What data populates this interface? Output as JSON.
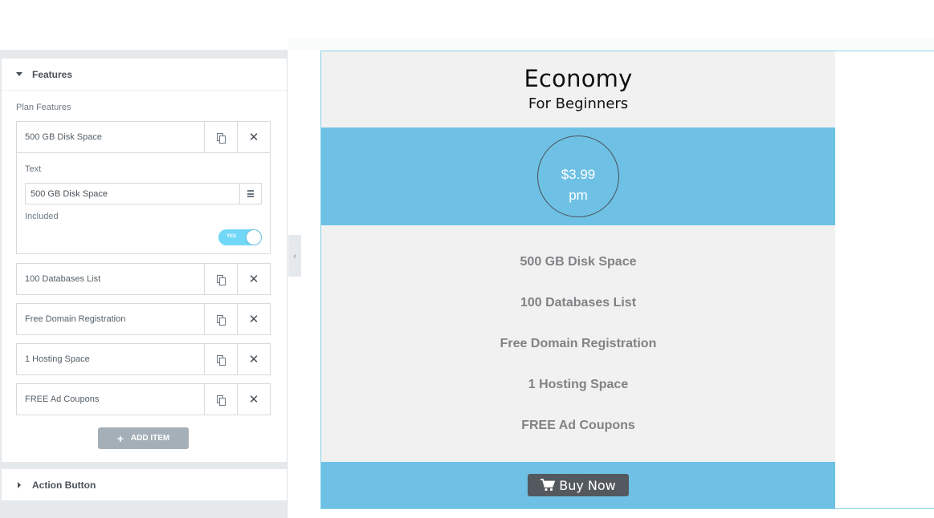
{
  "sidebar": {
    "features_section": {
      "title": "Features"
    },
    "plan_features_label": "Plan Features",
    "items": [
      {
        "title": "500 GB Disk Space",
        "expanded": true
      },
      {
        "title": "100 Databases List"
      },
      {
        "title": "Free Domain Registration"
      },
      {
        "title": "1 Hosting Space"
      },
      {
        "title": "FREE Ad Coupons"
      }
    ],
    "expanded_item": {
      "text_label": "Text",
      "text_value": "500 GB Disk Space",
      "included_label": "Included",
      "toggle_label": "YES",
      "toggle_on": true
    },
    "add_item_label": "ADD ITEM",
    "action_button_section": {
      "title": "Action Button"
    }
  },
  "preview": {
    "title": "Economy",
    "subtitle": "For Beginners",
    "price": "$3.99",
    "period": "pm",
    "features": [
      "500 GB Disk Space",
      "100 Databases List",
      "Free Domain Registration",
      "1 Hosting Space",
      "FREE Ad Coupons"
    ],
    "buy_label": "Buy Now"
  },
  "icons": {
    "section_toggle": "caret-icon",
    "duplicate": "copy-icon",
    "remove": "close-icon",
    "dynamic": "database-icon",
    "cart": "cart-icon",
    "collapse": "chevron-left-icon"
  },
  "colors": {
    "accent": "#6ec1e4",
    "toggle": "#71d7f7",
    "card_bg": "#f1f1f1",
    "button": "#54595f",
    "feature_text": "#808285"
  }
}
